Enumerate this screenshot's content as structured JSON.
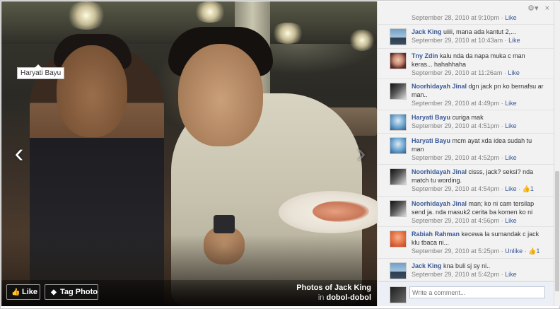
{
  "photo": {
    "tag_label": "Haryati Bayu",
    "like_label": "Like",
    "tag_photo_label": "Tag Photo",
    "album_title": "Photos of Jack King",
    "in_word": "in",
    "album_name": "dobol-dobol",
    "prev_arrow": "‹",
    "next_arrow": "›"
  },
  "panel": {
    "gear_icon": "⚙▾",
    "close_icon": "×",
    "comments": [
      {
        "author": "",
        "text": "",
        "timestamp": "September 28, 2010 at 9:10pm",
        "action": "Like",
        "likes": "",
        "avatar": "dark"
      },
      {
        "author": "Jack King",
        "text": "uiiii, mana ada kantut 2,...",
        "timestamp": "September 29, 2010 at 10:43am",
        "action": "Like",
        "likes": "",
        "avatar": "jack"
      },
      {
        "author": "Tny Zdin",
        "text": "kalu nda da napa muka c man keras... hahahhaha",
        "timestamp": "September 29, 2010 at 11:26am",
        "action": "Like",
        "likes": "",
        "avatar": "tny"
      },
      {
        "author": "Noorhidayah Jinal",
        "text": "dgn jack pn ko bernafsu ar man..",
        "timestamp": "September 29, 2010 at 4:49pm",
        "action": "Like",
        "likes": "",
        "avatar": "noor"
      },
      {
        "author": "Haryati Bayu",
        "text": "curiga mak",
        "timestamp": "September 29, 2010 at 4:51pm",
        "action": "Like",
        "likes": "",
        "avatar": "haryati"
      },
      {
        "author": "Haryati Bayu",
        "text": "mcm ayat xda idea sudah tu man",
        "timestamp": "September 29, 2010 at 4:52pm",
        "action": "Like",
        "likes": "",
        "avatar": "haryati"
      },
      {
        "author": "Noorhidayah Jinal",
        "text": "cisss, jack? seksi? nda match tu wording.",
        "timestamp": "September 29, 2010 at 4:54pm",
        "action": "Like",
        "likes": "1",
        "avatar": "noor"
      },
      {
        "author": "Noorhidayah Jinal",
        "text": "man; ko ni cam tersilap send ja. nda masuk2 cerita ba komen ko ni",
        "timestamp": "September 29, 2010 at 4:56pm",
        "action": "Like",
        "likes": "",
        "avatar": "noor"
      },
      {
        "author": "Rabiah Rahman",
        "text": "kecewa la sumandak c jack klu tbaca ni...",
        "timestamp": "September 29, 2010 at 5:25pm",
        "action": "Unlike",
        "likes": "1",
        "avatar": "rabiah"
      },
      {
        "author": "Jack King",
        "text": "kna buli sj sy ni..",
        "timestamp": "September 29, 2010 at 5:42pm",
        "action": "Like",
        "likes": "",
        "avatar": "jack"
      }
    ],
    "write_placeholder": "Write a comment..."
  },
  "colors": {
    "link_blue": "#3b5998",
    "meta_gray": "#808080",
    "comment_bg": "#f2f2f2"
  }
}
